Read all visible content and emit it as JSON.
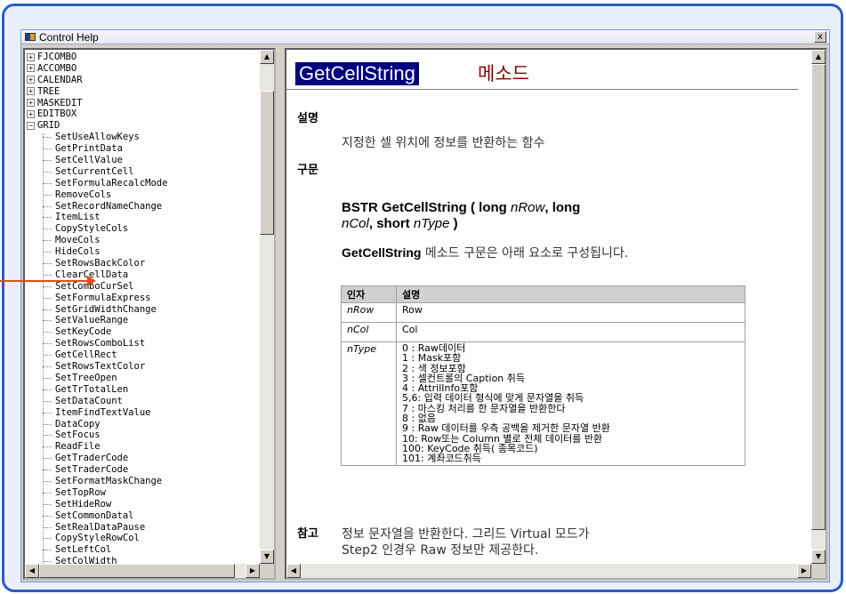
{
  "window": {
    "title": "Control Help",
    "close_glyph": "x"
  },
  "tree": {
    "top_items": [
      "FJCOMBO",
      "ACCOMBO",
      "CALENDAR",
      "TREE",
      "MASKEDIT",
      "EDITBOX"
    ],
    "expanded_item": "GRID",
    "children": [
      "SetUseAllowKeys",
      "GetPrintData",
      "SetCellValue",
      "SetCurrentCell",
      "SetFormulaRecalcMode",
      "RemoveCols",
      "SetRecordNameChange",
      "ItemList",
      "CopyStyleCols",
      "MoveCols",
      "HideCols",
      "SetRowsBackColor",
      "ClearCellData",
      "SetComboCurSel",
      "SetFormulaExpress",
      "SetGridWidthChange",
      "SetValueRange",
      "SetKeyCode",
      "SetRowsComboList",
      "GetCellRect",
      "SetRowsTextColor",
      "SetTreeOpen",
      "GetTrTotalLen",
      "SetDataCount",
      "ItemFindTextValue",
      "DataCopy",
      "SetFocus",
      "ReadFile",
      "GetTraderCode",
      "SetTraderCode",
      "SetFormatMaskChange",
      "SetTopRow",
      "SetHideRow",
      "SetCommonDatal",
      "SetRealDataPause",
      "CopyStyleRowCol",
      "SetLeftCol",
      "SetColWidth"
    ]
  },
  "doc": {
    "title_main": "GetCellString",
    "title_suffix": "메소드",
    "sections": {
      "desc": "설명",
      "syntax": "구문",
      "note": "참고"
    },
    "description": "지정한 셀 위치에 정보를 반환하는 함수",
    "syntax_prefix": "BSTR GetCellString ( long ",
    "syntax_p1": "nRow",
    "syntax_mid1": ", long",
    "syntax_p2": "nCol",
    "syntax_mid2": ", short ",
    "syntax_p3": "nType",
    "syntax_end": " )",
    "syntax_desc_method": "GetCellString",
    "syntax_desc_rest": " 메소드 구문은 아래 요소로 구성됩니다.",
    "table": {
      "headers": [
        "인자",
        "설명"
      ],
      "rows": [
        {
          "name": "nRow",
          "desc": "Row"
        },
        {
          "name": "nCol",
          "desc": "Col"
        },
        {
          "name": "nType",
          "lines": [
            "0 : Raw데이터",
            "1 : Mask포함",
            "2 : 색 정보포함",
            "3 : 셀컨트롤의 Caption 취득",
            "4 : AttrilInfo포함",
            "5,6: 입력 데이터 형식에 맞게 문자열을 취득",
            "7 : 마스킹 처리를 한 문자열을 반환한다",
            "8 : 없음",
            "9 : Raw 데이터를 우측 공백을 제거한 문자열 반환",
            "10: Row또는 Column 별로 전체 데이터를 반환",
            "100: KeyCode 취득( 종목코드)",
            "101: 계좌코드취득"
          ]
        }
      ]
    },
    "note_line1": "정보 문자열을 반환한다. 그리드 Virtual 모드가",
    "note_line2": "Step2 인경우 Raw 정보만 제공한다."
  },
  "annotation": {
    "arrow_color": "#e84a10"
  }
}
